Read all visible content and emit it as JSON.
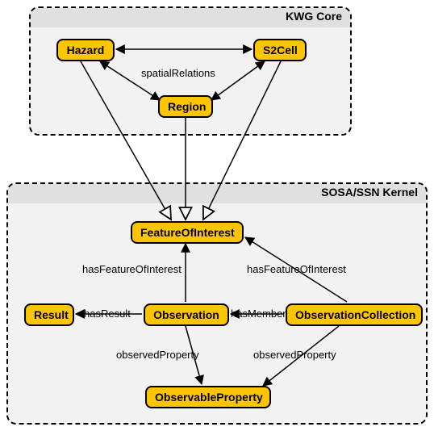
{
  "containers": {
    "kwg": {
      "title": "KWG Core"
    },
    "sosa": {
      "title": "SOSA/SSN Kernel"
    }
  },
  "nodes": {
    "hazard": "Hazard",
    "s2cell": "S2Cell",
    "region": "Region",
    "foi": "FeatureOfInterest",
    "result": "Result",
    "observation": "Observation",
    "obscoll": "ObservationCollection",
    "obsprop": "ObservableProperty"
  },
  "edges": {
    "spatialRelations": "spatialRelations",
    "hasFOI_left": "hasFeatureOfInterest",
    "hasFOI_right": "hasFeatureOfInterest",
    "hasResult": "hasResult",
    "hasMember": "hasMember",
    "observedProperty_left": "observedProperty",
    "observedProperty_right": "observedProperty"
  },
  "chart_data": {
    "type": "diagram",
    "title": "",
    "containers": [
      {
        "id": "kwg",
        "label": "KWG Core",
        "nodes": [
          "Hazard",
          "S2Cell",
          "Region"
        ]
      },
      {
        "id": "sosa",
        "label": "SOSA/SSN Kernel",
        "nodes": [
          "FeatureOfInterest",
          "Result",
          "Observation",
          "ObservationCollection",
          "ObservableProperty"
        ]
      }
    ],
    "nodes": [
      "Hazard",
      "S2Cell",
      "Region",
      "FeatureOfInterest",
      "Result",
      "Observation",
      "ObservationCollection",
      "ObservableProperty"
    ],
    "edges": [
      {
        "from": "Hazard",
        "to": "S2Cell",
        "label": "spatialRelations",
        "bidirectional": true,
        "arrow": "solid"
      },
      {
        "from": "Hazard",
        "to": "Region",
        "label": "spatialRelations",
        "bidirectional": true,
        "arrow": "solid"
      },
      {
        "from": "S2Cell",
        "to": "Region",
        "label": "spatialRelations",
        "bidirectional": true,
        "arrow": "solid"
      },
      {
        "from": "Hazard",
        "to": "FeatureOfInterest",
        "label": "",
        "arrow": "hollow"
      },
      {
        "from": "Region",
        "to": "FeatureOfInterest",
        "label": "",
        "arrow": "hollow"
      },
      {
        "from": "S2Cell",
        "to": "FeatureOfInterest",
        "label": "",
        "arrow": "hollow"
      },
      {
        "from": "Observation",
        "to": "FeatureOfInterest",
        "label": "hasFeatureOfInterest",
        "arrow": "solid"
      },
      {
        "from": "ObservationCollection",
        "to": "FeatureOfInterest",
        "label": "hasFeatureOfInterest",
        "arrow": "solid"
      },
      {
        "from": "Observation",
        "to": "Result",
        "label": "hasResult",
        "arrow": "solid"
      },
      {
        "from": "ObservationCollection",
        "to": "Observation",
        "label": "hasMember",
        "arrow": "solid"
      },
      {
        "from": "Observation",
        "to": "ObservableProperty",
        "label": "observedProperty",
        "arrow": "solid"
      },
      {
        "from": "ObservationCollection",
        "to": "ObservableProperty",
        "label": "observedProperty",
        "arrow": "solid"
      }
    ]
  }
}
